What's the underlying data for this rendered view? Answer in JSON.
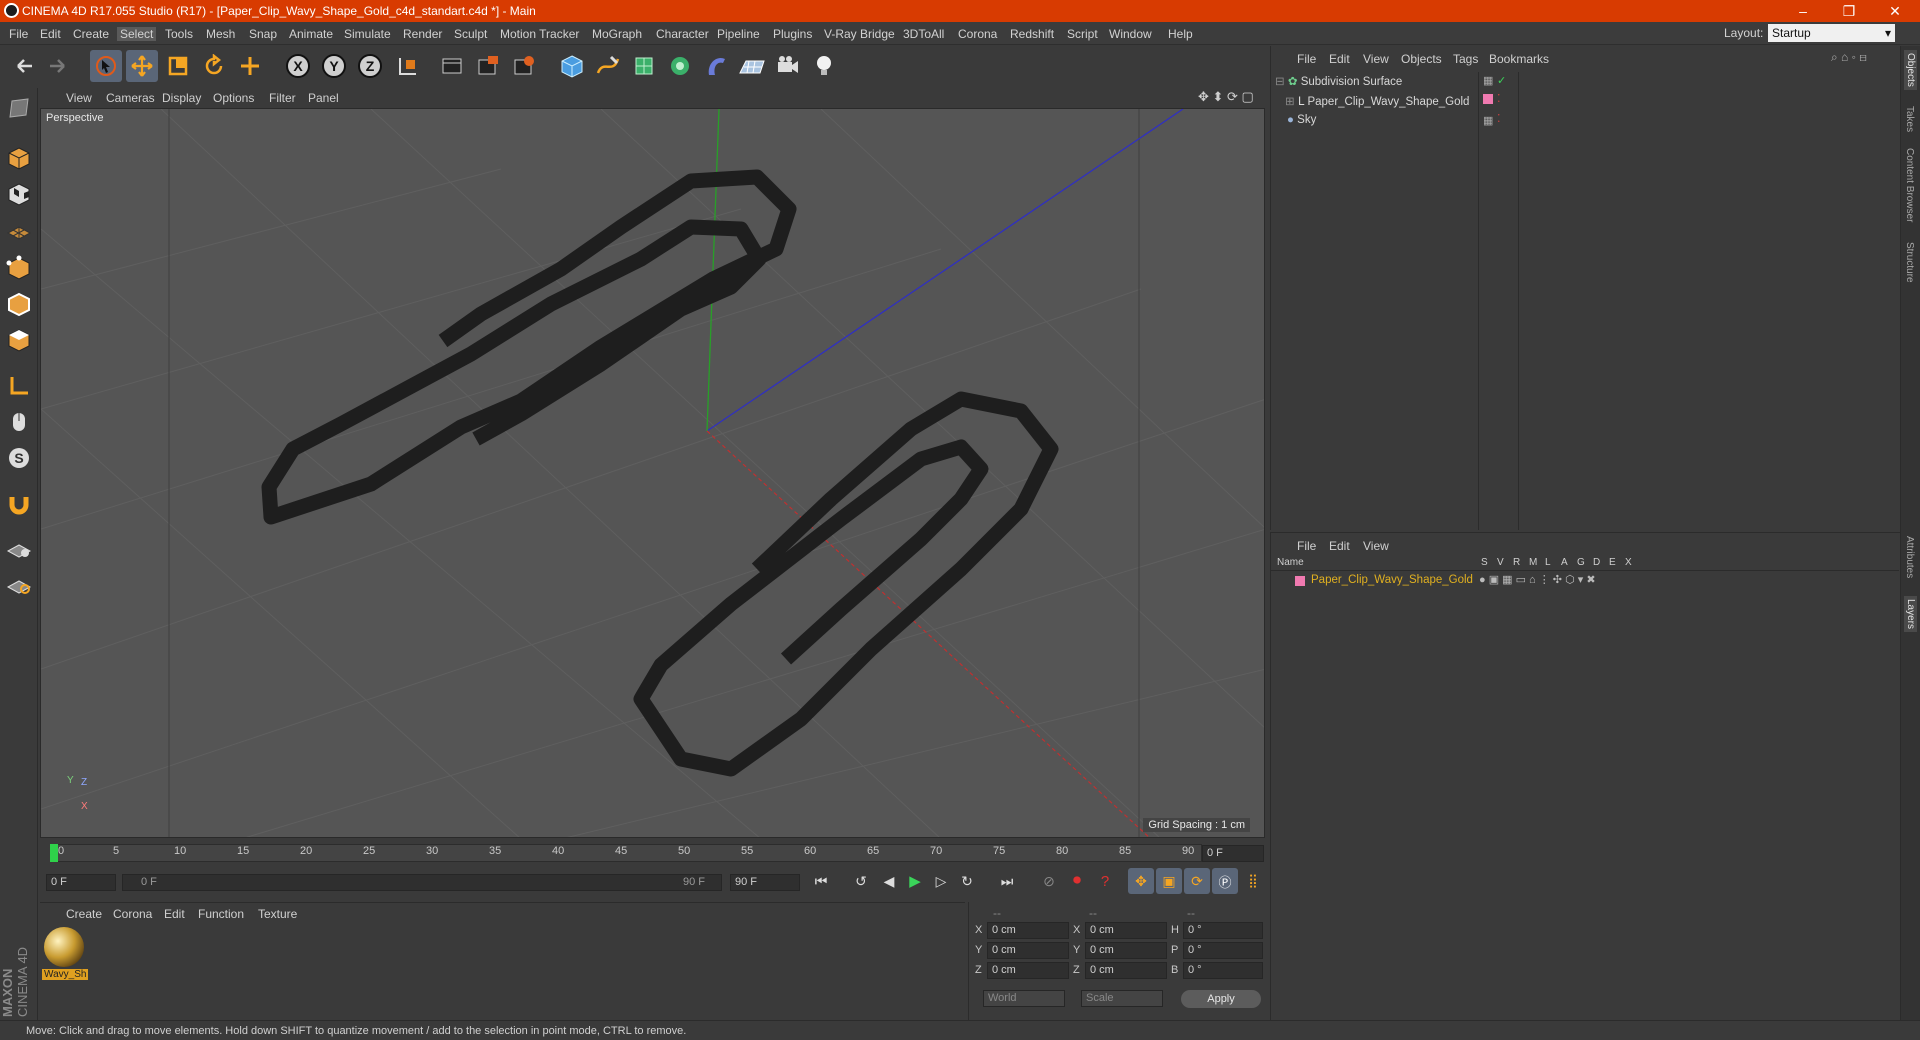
{
  "window": {
    "title": "CINEMA 4D R17.055 Studio (R17) - [Paper_Clip_Wavy_Shape_Gold_c4d_standart.c4d *] - Main",
    "minimize": "–",
    "maximize": "❐",
    "close": "✕"
  },
  "menubar": {
    "items": [
      "File",
      "Edit",
      "Create",
      "Select",
      "Tools",
      "Mesh",
      "Snap",
      "Animate",
      "Simulate",
      "Render",
      "Sculpt",
      "Motion Tracker",
      "MoGraph",
      "Character",
      "Pipeline",
      "Plugins",
      "V-Ray Bridge",
      "3DToAll",
      "Corona",
      "Redshift",
      "Script",
      "Window",
      "Help"
    ],
    "selected": "Select",
    "layout_label": "Layout:",
    "layout_value": "Startup"
  },
  "toolbar": {
    "icons": [
      "undo-icon",
      "redo-icon",
      "select-arrow-icon",
      "move-icon",
      "scale-icon",
      "rotate-icon",
      "transform-icon",
      "x-axis-icon",
      "y-axis-icon",
      "z-axis-icon",
      "coordinate-system-icon",
      "render-view-icon",
      "render-picture-viewer-icon",
      "render-settings-icon",
      "cube-primitive-icon",
      "spline-pen-icon",
      "subdivision-icon",
      "cloner-icon",
      "deformer-icon",
      "floor-icon",
      "camera-icon",
      "light-icon"
    ]
  },
  "left_tools": {
    "icons": [
      "make-editable-icon",
      "model-mode-icon",
      "texture-mode-icon",
      "workplane-mode-icon",
      "points-mode-icon",
      "edges-mode-icon",
      "polygons-mode-icon",
      "axis-mode-icon",
      "tweak-mode-icon",
      "solo-icon",
      "magnet-icon",
      "snap-grid-icon",
      "snap-settings-icon"
    ]
  },
  "viewport": {
    "menu": [
      "View",
      "Cameras",
      "Display",
      "Options",
      "Filter",
      "Panel"
    ],
    "label": "Perspective",
    "grid_spacing": "Grid Spacing : 1 cm",
    "axis_x": "X",
    "axis_y": "Y",
    "axis_z": "Z"
  },
  "timeline": {
    "ticks": [
      "0",
      "5",
      "10",
      "15",
      "20",
      "25",
      "30",
      "35",
      "40",
      "45",
      "50",
      "55",
      "60",
      "65",
      "70",
      "75",
      "80",
      "85",
      "90"
    ],
    "current_frame": "0 F",
    "start_field": "0 F",
    "range_start": "0 F",
    "range_end": "90 F",
    "end_field": "90 F"
  },
  "material_manager": {
    "menu": [
      "Create",
      "Corona",
      "Edit",
      "Function",
      "Texture"
    ],
    "materials": [
      {
        "name": "Wavy_Sh"
      }
    ]
  },
  "coordinates": {
    "header": [
      "--",
      "--",
      "--"
    ],
    "rows": [
      {
        "a": "X",
        "av": "0 cm",
        "b": "X",
        "bv": "0 cm",
        "c": "H",
        "cv": "0 °"
      },
      {
        "a": "Y",
        "av": "0 cm",
        "b": "Y",
        "bv": "0 cm",
        "c": "P",
        "cv": "0 °"
      },
      {
        "a": "Z",
        "av": "0 cm",
        "b": "Z",
        "bv": "0 cm",
        "c": "B",
        "cv": "0 °"
      }
    ],
    "mode1": "World",
    "mode2": "Scale",
    "apply": "Apply"
  },
  "object_manager": {
    "menu": [
      "File",
      "Edit",
      "View",
      "Objects",
      "Tags",
      "Bookmarks"
    ],
    "objects": [
      {
        "name": "Subdivision Surface",
        "icon": "subdivision-icon",
        "color": "#7fd27f"
      },
      {
        "name": "Paper_Clip_Wavy_Shape_Gold",
        "icon": "polygon-object-icon",
        "color": "#d8d8d8"
      },
      {
        "name": "Sky",
        "icon": "sky-icon",
        "color": "#9ab4d8"
      }
    ]
  },
  "layer_manager": {
    "menu": [
      "File",
      "Edit",
      "View"
    ],
    "columns": [
      "Name",
      "S",
      "V",
      "R",
      "M",
      "L",
      "A",
      "G",
      "D",
      "E",
      "X"
    ],
    "layers": [
      {
        "name": "Paper_Clip_Wavy_Shape_Gold",
        "color": "#e0b020",
        "swatch": "#f07ab0"
      }
    ]
  },
  "right_tabs": [
    "Objects",
    "Takes",
    "Content Browser",
    "Structure",
    "Attributes",
    "Layers"
  ],
  "status": "Move: Click and drag to move elements. Hold down SHIFT to quantize movement / add to the selection in point mode, CTRL to remove.",
  "branding": {
    "maxon": "MAXON",
    "c4d": "CINEMA 4D"
  }
}
